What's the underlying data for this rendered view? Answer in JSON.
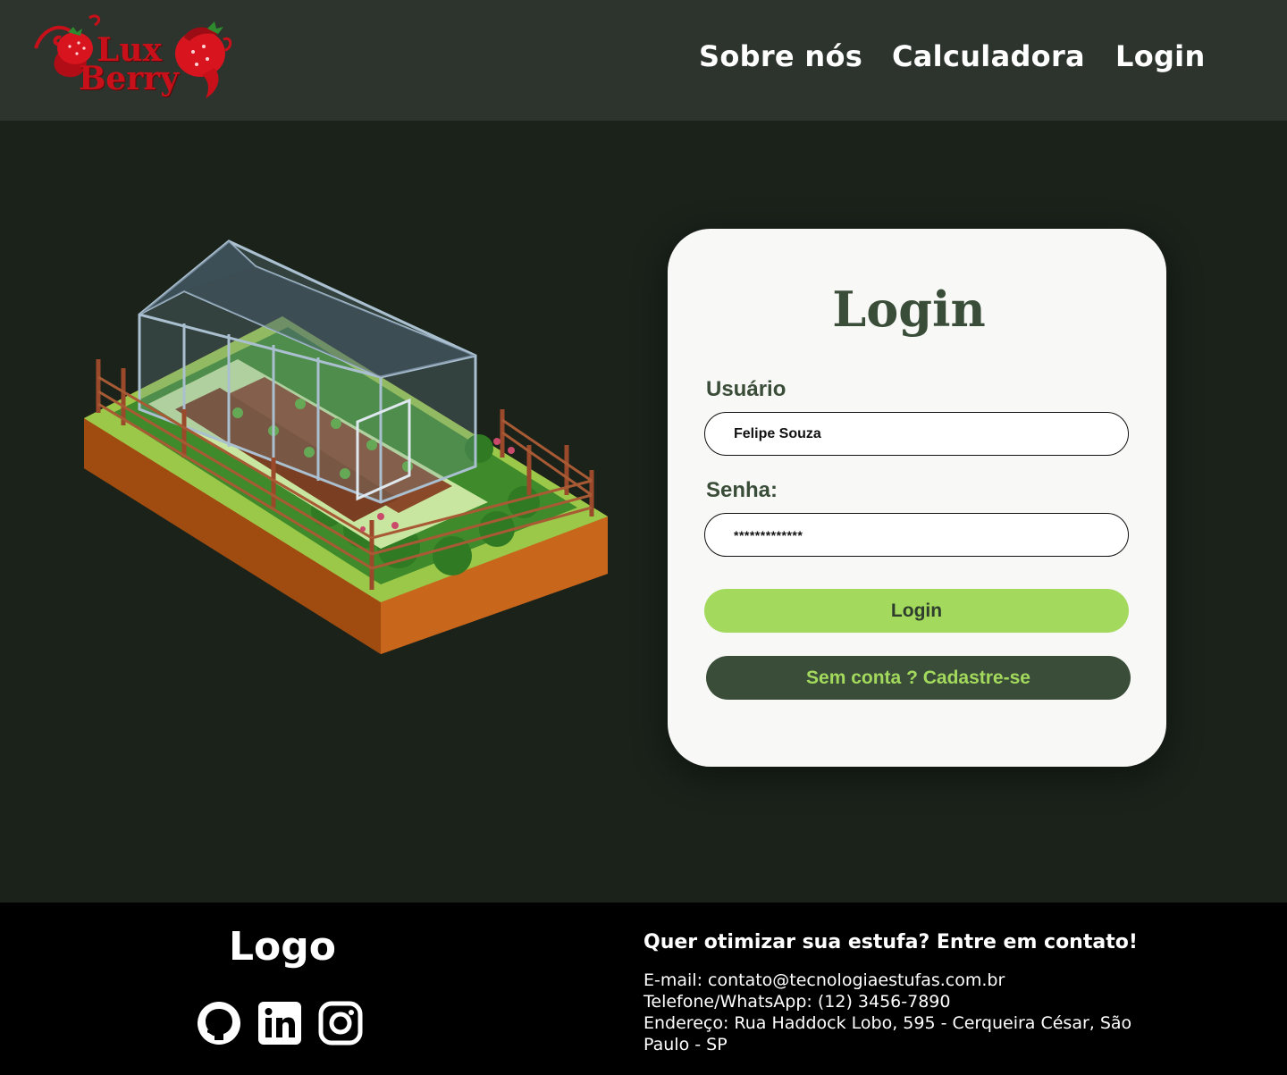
{
  "header": {
    "logo": {
      "line1": "Lux",
      "line2": "Berry"
    },
    "nav": {
      "about": "Sobre nós",
      "calculator": "Calculadora",
      "login": "Login"
    }
  },
  "login_card": {
    "title": "Login",
    "username_label": "Usuário",
    "username_value": "Felipe Souza",
    "password_label": "Senha:",
    "password_value": "*************",
    "login_button": "Login",
    "signup_button": "Sem conta ? Cadastre-se"
  },
  "footer": {
    "logo": "Logo",
    "social_icons": [
      "github-icon",
      "linkedin-icon",
      "instagram-icon"
    ],
    "contact_title": "Quer otimizar sua estufa? Entre em contato!",
    "email": "E-mail: contato@tecnologiaestufas.com.br",
    "phone": "Telefone/WhatsApp: (12) 3456-7890",
    "address": "Endereço: Rua Haddock Lobo, 595 - Cerqueira César, São Paulo - SP"
  },
  "colors": {
    "header_bg": "#2c342d",
    "page_bg": "#1a221a",
    "card_bg": "#f8f8f7",
    "accent_green": "#a3d95c",
    "dark_green": "#3a4d38",
    "brand_red": "#c8101a",
    "footer_bg": "#000000"
  }
}
